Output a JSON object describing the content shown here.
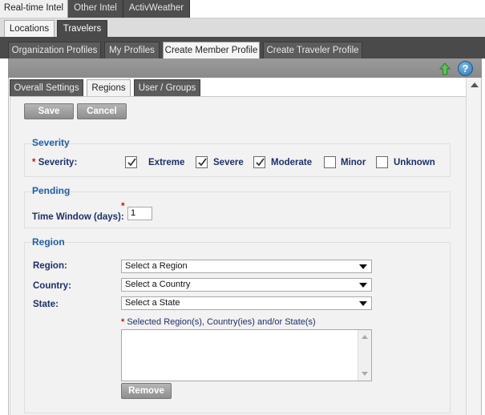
{
  "top_tabs": [
    {
      "label": "Real-time Intel",
      "active": true
    },
    {
      "label": "Other Intel",
      "active": false
    },
    {
      "label": "ActivWeather",
      "active": false
    }
  ],
  "sub_tabs": [
    {
      "label": "Locations",
      "active": false
    },
    {
      "label": "Travelers",
      "active": true
    }
  ],
  "profile_tabs": [
    {
      "label": "Organization Profiles",
      "active": false
    },
    {
      "label": "My Profiles",
      "active": false
    },
    {
      "label": "Create Member Profile",
      "active": true
    },
    {
      "label": "Create Traveler Profile",
      "active": false
    }
  ],
  "toolbar": {
    "help_glyph": "?"
  },
  "inner_tabs": [
    {
      "label": "Overall Settings",
      "active": false
    },
    {
      "label": "Regions",
      "active": true
    },
    {
      "label": "User / Groups",
      "active": false
    }
  ],
  "actions": {
    "save_label": "Save",
    "cancel_label": "Cancel"
  },
  "severity": {
    "title": "Severity",
    "required_mark": "*",
    "field_label": "Severity:",
    "options": [
      {
        "label": "Extreme",
        "checked": true
      },
      {
        "label": "Severe",
        "checked": true
      },
      {
        "label": "Moderate",
        "checked": true
      },
      {
        "label": "Minor",
        "checked": false
      },
      {
        "label": "Unknown",
        "checked": false
      }
    ]
  },
  "pending": {
    "title": "Pending",
    "required_mark": "*",
    "field_label": "Time Window (days):",
    "value": "1"
  },
  "region": {
    "title": "Region",
    "region_label": "Region:",
    "region_value": "Select a Region",
    "country_label": "Country:",
    "country_value": "Select a Country",
    "state_label": "State:",
    "state_value": "Select a State",
    "required_mark": "*",
    "selected_label": "Selected Region(s), Country(ies) and/or State(s)",
    "remove_label": "Remove"
  },
  "colors": {
    "section_title": "#1f5fa8",
    "label": "#1c2f68",
    "required": "#d01010",
    "tab_dark": "#4a4a4a"
  }
}
